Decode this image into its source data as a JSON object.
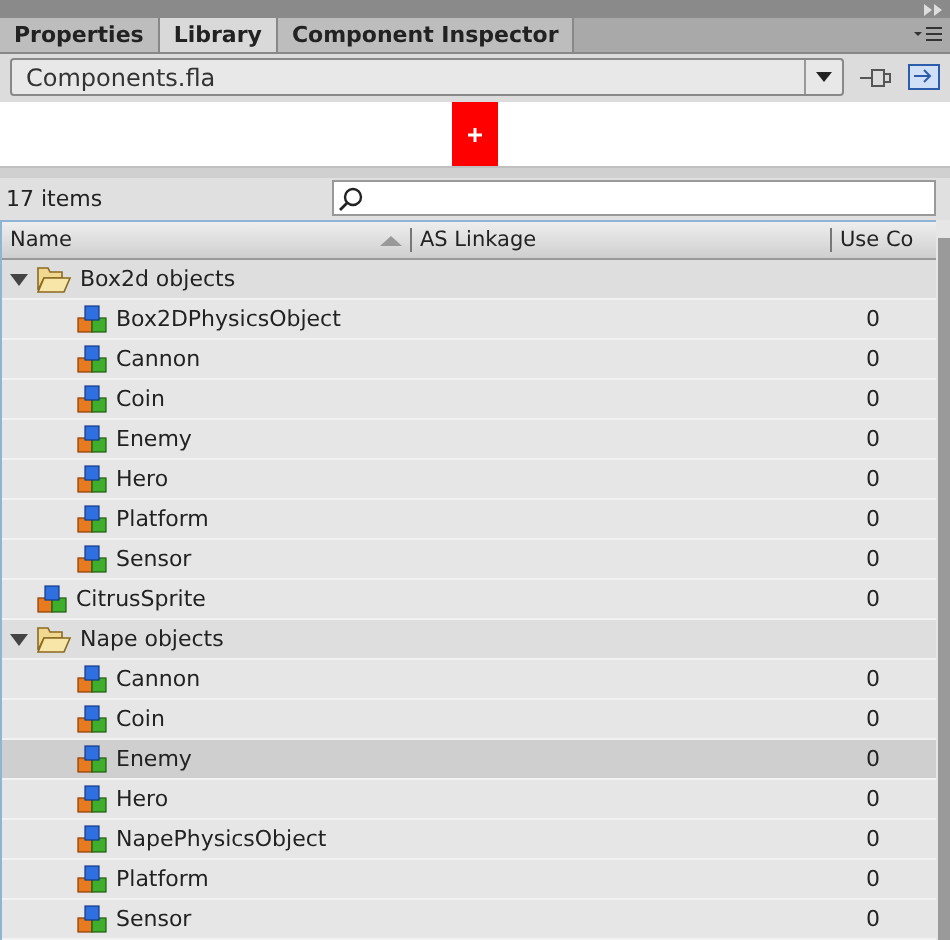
{
  "tabs": [
    {
      "label": "Properties",
      "selected": false
    },
    {
      "label": "Library",
      "selected": true
    },
    {
      "label": "Component Inspector",
      "selected": false
    }
  ],
  "document_select": {
    "value": "Components.fla"
  },
  "item_count": "17 items",
  "columns": [
    "Name",
    "AS Linkage",
    "Use Co"
  ],
  "tree": [
    {
      "kind": "folder",
      "name": "Box2d objects",
      "expanded": true,
      "selected": false,
      "children": [
        {
          "kind": "symbol",
          "name": "Box2DPhysicsObject",
          "use_count": "0",
          "selected": false
        },
        {
          "kind": "symbol",
          "name": "Cannon",
          "use_count": "0",
          "selected": false
        },
        {
          "kind": "symbol",
          "name": "Coin",
          "use_count": "0",
          "selected": false
        },
        {
          "kind": "symbol",
          "name": "Enemy",
          "use_count": "0",
          "selected": false
        },
        {
          "kind": "symbol",
          "name": "Hero",
          "use_count": "0",
          "selected": false
        },
        {
          "kind": "symbol",
          "name": "Platform",
          "use_count": "0",
          "selected": false
        },
        {
          "kind": "symbol",
          "name": "Sensor",
          "use_count": "0",
          "selected": false
        }
      ]
    },
    {
      "kind": "symbol",
      "name": "CitrusSprite",
      "use_count": "0",
      "selected": false
    },
    {
      "kind": "folder",
      "name": "Nape objects",
      "expanded": true,
      "selected": false,
      "children": [
        {
          "kind": "symbol",
          "name": "Cannon",
          "use_count": "0",
          "selected": false
        },
        {
          "kind": "symbol",
          "name": "Coin",
          "use_count": "0",
          "selected": false
        },
        {
          "kind": "symbol",
          "name": "Enemy",
          "use_count": "0",
          "selected": true
        },
        {
          "kind": "symbol",
          "name": "Hero",
          "use_count": "0",
          "selected": false
        },
        {
          "kind": "symbol",
          "name": "NapePhysicsObject",
          "use_count": "0",
          "selected": false
        },
        {
          "kind": "symbol",
          "name": "Platform",
          "use_count": "0",
          "selected": false
        },
        {
          "kind": "symbol",
          "name": "Sensor",
          "use_count": "0",
          "selected": false
        }
      ]
    }
  ]
}
